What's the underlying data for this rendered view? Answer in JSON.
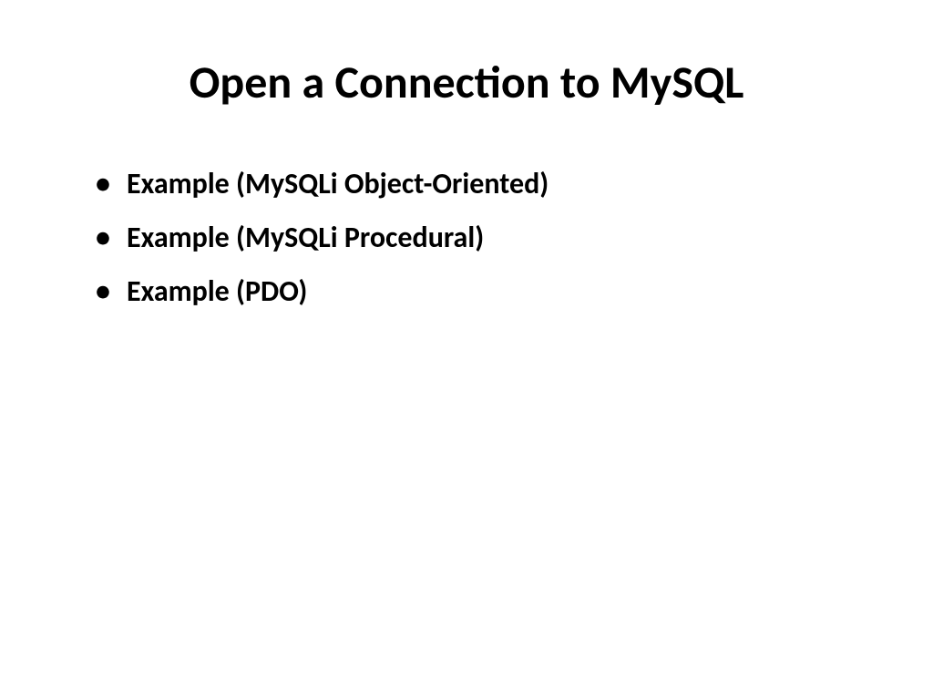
{
  "slide": {
    "title": "Open a Connection to MySQL",
    "bullets": [
      "Example (MySQLi Object-Oriented)",
      "Example (MySQLi Procedural)",
      "Example (PDO)"
    ]
  }
}
